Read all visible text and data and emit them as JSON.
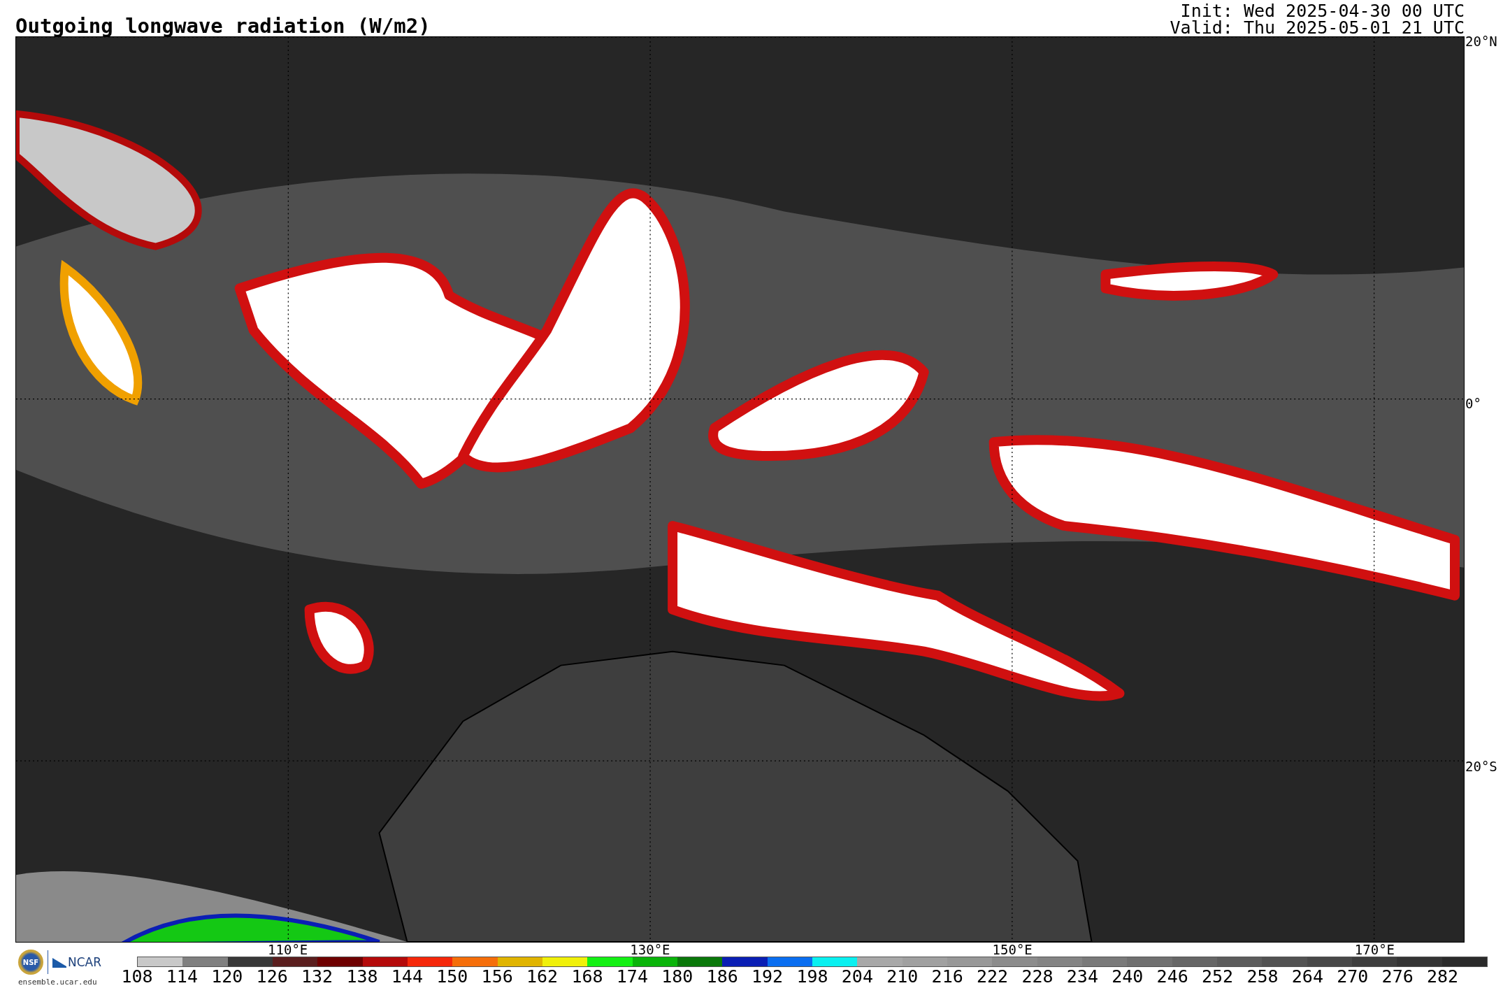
{
  "title": "Outgoing longwave radiation (W/m2)",
  "init": "Init: Wed 2025-04-30 00 UTC",
  "valid": "Valid: Thu 2025-05-01 21 UTC",
  "map": {
    "lat_labels": [
      "20°N",
      "0°",
      "20°S"
    ],
    "lon_labels": [
      "110°E",
      "130°E",
      "150°E",
      "170°E"
    ]
  },
  "logo": {
    "nsf": "NSF",
    "ncar": "NCAR",
    "url": "ensemble.ucar.edu"
  },
  "colorbar": [
    {
      "label": "108",
      "color": "#c8c8c8"
    },
    {
      "label": "114",
      "color": "#808080"
    },
    {
      "label": "120",
      "color": "#383838"
    },
    {
      "label": "126",
      "color": "#5a1e1e"
    },
    {
      "label": "132",
      "color": "#6e0000"
    },
    {
      "label": "138",
      "color": "#b40a0a"
    },
    {
      "label": "144",
      "color": "#f5280a"
    },
    {
      "label": "150",
      "color": "#f56e0a"
    },
    {
      "label": "156",
      "color": "#e0b400"
    },
    {
      "label": "162",
      "color": "#f0f00a"
    },
    {
      "label": "168",
      "color": "#14f014"
    },
    {
      "label": "174",
      "color": "#0ab40a"
    },
    {
      "label": "180",
      "color": "#0a780a"
    },
    {
      "label": "186",
      "color": "#0a1eb4"
    },
    {
      "label": "192",
      "color": "#0a6ef0"
    },
    {
      "label": "198",
      "color": "#0af0f0"
    },
    {
      "label": "204",
      "color": "#a8a8a8"
    },
    {
      "label": "210",
      "color": "#a0a0a0"
    },
    {
      "label": "216",
      "color": "#989898"
    },
    {
      "label": "222",
      "color": "#8c8c8c"
    },
    {
      "label": "228",
      "color": "#848484"
    },
    {
      "label": "234",
      "color": "#7a7a7a"
    },
    {
      "label": "240",
      "color": "#707070"
    },
    {
      "label": "246",
      "color": "#666666"
    },
    {
      "label": "252",
      "color": "#5c5c5c"
    },
    {
      "label": "258",
      "color": "#525252"
    },
    {
      "label": "264",
      "color": "#484848"
    },
    {
      "label": "270",
      "color": "#3e3e3e"
    },
    {
      "label": "276",
      "color": "#343434"
    },
    {
      "label": "282",
      "color": "#2a2a2a"
    }
  ]
}
